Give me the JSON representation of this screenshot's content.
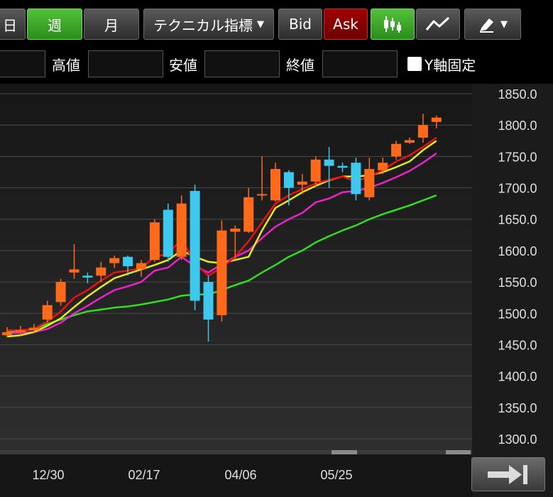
{
  "toolbar": {
    "partial_left_label": "日",
    "week_label": "週",
    "month_label": "月",
    "technical_label": "テクニカル指標",
    "bid_label": "Bid",
    "ask_label": "Ask",
    "candle_icon": "candlestick-icon",
    "line_icon": "line-chart-icon",
    "draw_icon": "drawing-tool-icon",
    "active_color": "#3aa82a",
    "ask_color": "#8b0000"
  },
  "ohlc_bar": {
    "high_label": "高値",
    "low_label": "安値",
    "close_label": "終値",
    "yaxis_fixed_label": "Y軸固定"
  },
  "nav": {
    "jump_to_latest_icon": "jump-to-end-icon"
  },
  "chart_data": {
    "type": "candlestick",
    "yaxis": {
      "min": 1300,
      "max": 1850,
      "ticks": [
        "1850.0",
        "1800.0",
        "1750.0",
        "1700.0",
        "1650.0",
        "1600.0",
        "1550.0",
        "1500.0",
        "1450.0",
        "1400.0",
        "1350.0",
        "1300.0"
      ]
    },
    "xaxis_labels": [
      "12/30",
      "02/17",
      "04/06",
      "05/25"
    ],
    "colors": {
      "up": "#ff6a1a",
      "down": "#3ec8ee",
      "ma_short": "#ee1111",
      "ma_mid": "#e8e81e",
      "ma_long": "#ee22cc",
      "ma_xlong": "#33dd22"
    },
    "candles": [
      {
        "o": 1465,
        "h": 1478,
        "l": 1462,
        "c": 1470
      },
      {
        "o": 1470,
        "h": 1480,
        "l": 1465,
        "c": 1473
      },
      {
        "o": 1473,
        "h": 1483,
        "l": 1468,
        "c": 1477
      },
      {
        "o": 1490,
        "h": 1520,
        "l": 1485,
        "c": 1513
      },
      {
        "o": 1518,
        "h": 1555,
        "l": 1512,
        "c": 1550
      },
      {
        "o": 1565,
        "h": 1610,
        "l": 1555,
        "c": 1570
      },
      {
        "o": 1560,
        "h": 1565,
        "l": 1548,
        "c": 1557
      },
      {
        "o": 1560,
        "h": 1582,
        "l": 1550,
        "c": 1573
      },
      {
        "o": 1580,
        "h": 1592,
        "l": 1572,
        "c": 1588
      },
      {
        "o": 1590,
        "h": 1592,
        "l": 1560,
        "c": 1575
      },
      {
        "o": 1570,
        "h": 1585,
        "l": 1558,
        "c": 1580
      },
      {
        "o": 1585,
        "h": 1650,
        "l": 1582,
        "c": 1645
      },
      {
        "o": 1665,
        "h": 1675,
        "l": 1582,
        "c": 1590
      },
      {
        "o": 1590,
        "h": 1688,
        "l": 1585,
        "c": 1675
      },
      {
        "o": 1695,
        "h": 1705,
        "l": 1505,
        "c": 1520
      },
      {
        "o": 1550,
        "h": 1560,
        "l": 1455,
        "c": 1490
      },
      {
        "o": 1497,
        "h": 1648,
        "l": 1487,
        "c": 1632
      },
      {
        "o": 1630,
        "h": 1640,
        "l": 1585,
        "c": 1635
      },
      {
        "o": 1630,
        "h": 1700,
        "l": 1628,
        "c": 1685
      },
      {
        "o": 1688,
        "h": 1750,
        "l": 1680,
        "c": 1690
      },
      {
        "o": 1680,
        "h": 1740,
        "l": 1678,
        "c": 1730
      },
      {
        "o": 1725,
        "h": 1728,
        "l": 1672,
        "c": 1700
      },
      {
        "o": 1705,
        "h": 1722,
        "l": 1690,
        "c": 1710
      },
      {
        "o": 1710,
        "h": 1750,
        "l": 1702,
        "c": 1745
      },
      {
        "o": 1745,
        "h": 1765,
        "l": 1700,
        "c": 1735
      },
      {
        "o": 1735,
        "h": 1740,
        "l": 1725,
        "c": 1732
      },
      {
        "o": 1740,
        "h": 1748,
        "l": 1680,
        "c": 1690
      },
      {
        "o": 1685,
        "h": 1748,
        "l": 1680,
        "c": 1730
      },
      {
        "o": 1728,
        "h": 1748,
        "l": 1722,
        "c": 1740
      },
      {
        "o": 1750,
        "h": 1775,
        "l": 1745,
        "c": 1770
      },
      {
        "o": 1772,
        "h": 1780,
        "l": 1770,
        "c": 1776
      },
      {
        "o": 1780,
        "h": 1818,
        "l": 1772,
        "c": 1800
      },
      {
        "o": 1805,
        "h": 1815,
        "l": 1795,
        "c": 1812
      }
    ],
    "ma_short": [
      1473,
      1473,
      1475,
      1487,
      1503,
      1525,
      1537,
      1552,
      1565,
      1568,
      1572,
      1590,
      1595,
      1618,
      1580,
      1560,
      1573,
      1590,
      1615,
      1645,
      1675,
      1688,
      1698,
      1707,
      1713,
      1718,
      1710,
      1718,
      1728,
      1742,
      1752,
      1765,
      1780
    ],
    "ma_mid": [
      1463,
      1465,
      1470,
      1480,
      1492,
      1510,
      1527,
      1542,
      1556,
      1563,
      1570,
      1577,
      1585,
      1600,
      1590,
      1582,
      1580,
      1585,
      1590,
      1632,
      1668,
      1680,
      1693,
      1703,
      1712,
      1718,
      1718,
      1720,
      1725,
      1733,
      1742,
      1760,
      1775
    ],
    "ma_long": [
      1468,
      1469,
      1470,
      1475,
      1485,
      1500,
      1512,
      1525,
      1537,
      1543,
      1550,
      1568,
      1573,
      1590,
      1575,
      1565,
      1578,
      1590,
      1600,
      1620,
      1638,
      1650,
      1660,
      1677,
      1683,
      1693,
      1695,
      1700,
      1708,
      1717,
      1727,
      1740,
      1755
    ],
    "ma_xlong": [
      1470,
      1472,
      1475,
      1483,
      1490,
      1497,
      1503,
      1506,
      1509,
      1511,
      1514,
      1518,
      1522,
      1528,
      1530,
      1530,
      1537,
      1545,
      1552,
      1565,
      1577,
      1590,
      1600,
      1613,
      1623,
      1632,
      1640,
      1650,
      1658,
      1665,
      1672,
      1680,
      1688
    ]
  }
}
